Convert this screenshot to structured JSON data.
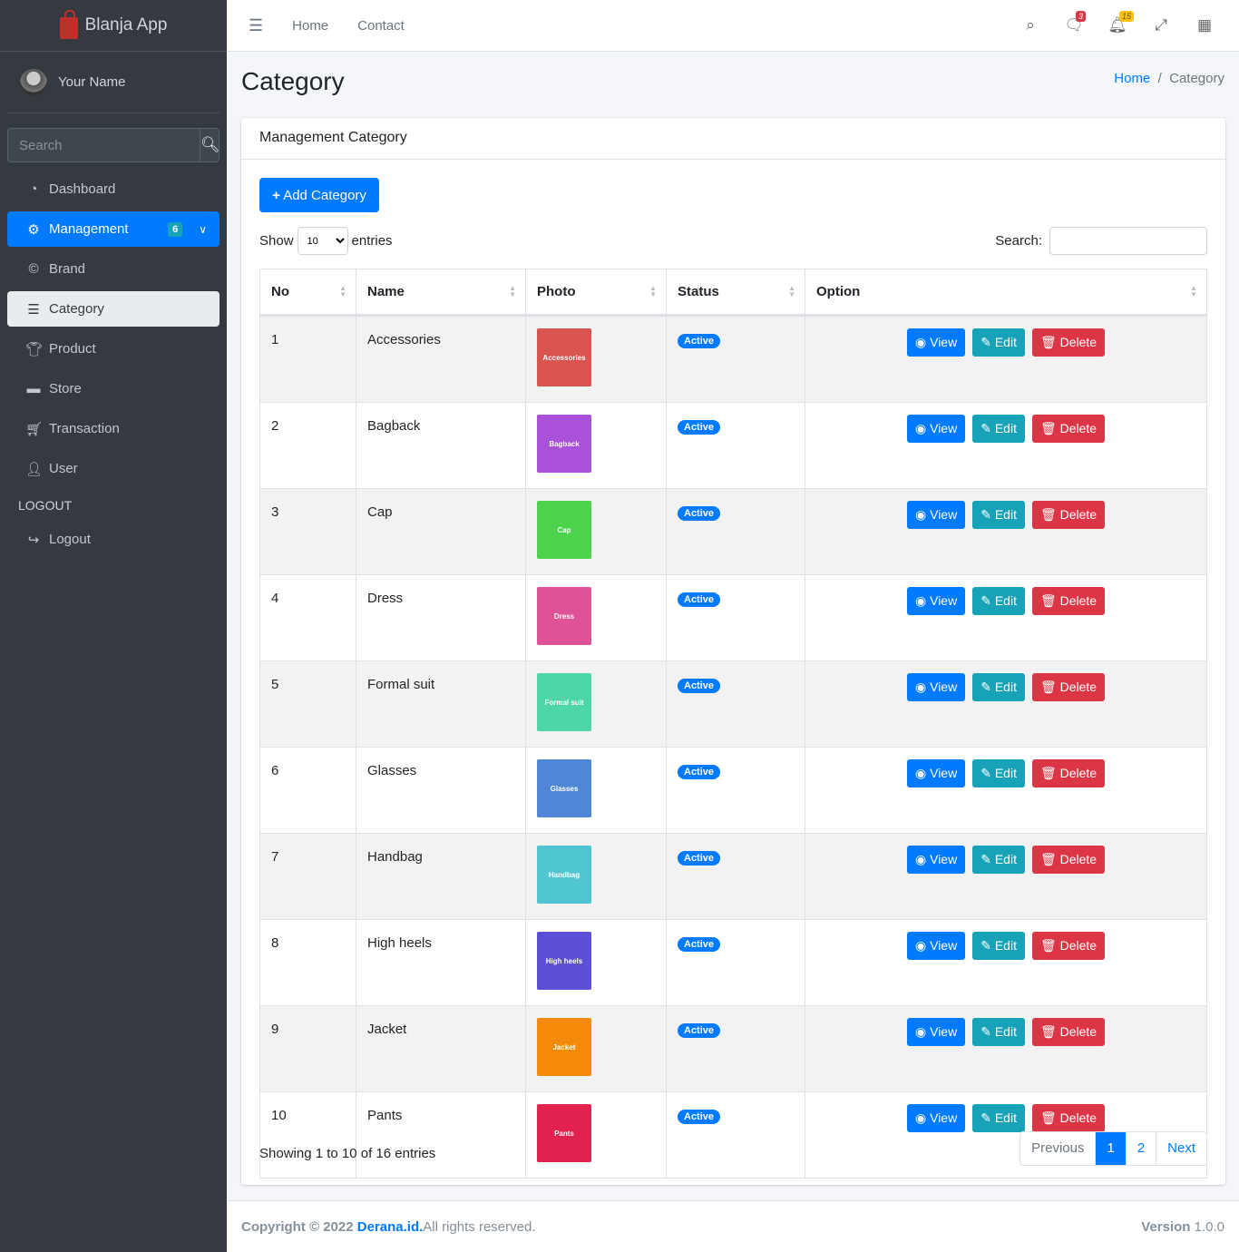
{
  "app": {
    "name": "Blanja App",
    "user": "Your Name"
  },
  "sidebar": {
    "search_placeholder": "Search",
    "items": [
      {
        "label": "Dashboard",
        "icon": "tachometer-icon"
      },
      {
        "label": "Management",
        "icon": "gear-icon",
        "badge": "6"
      },
      {
        "label": "Brand",
        "icon": "copyright-icon"
      },
      {
        "label": "Category",
        "icon": "list-icon"
      },
      {
        "label": "Product",
        "icon": "tshirt-icon"
      },
      {
        "label": "Store",
        "icon": "store-icon"
      },
      {
        "label": "Transaction",
        "icon": "cart-icon"
      },
      {
        "label": "User",
        "icon": "user-icon"
      }
    ],
    "header": "LOGOUT",
    "logout": "Logout"
  },
  "topbar": {
    "home": "Home",
    "contact": "Contact",
    "messages_count": "3",
    "notifications_count": "15"
  },
  "page": {
    "title": "Category",
    "breadcrumb": [
      "Home",
      "Category"
    ]
  },
  "card": {
    "title": "Management Category",
    "add_label": "Add Category",
    "show_label": "Show",
    "entries_label": "entries",
    "page_size": "10",
    "search_label": "Search:",
    "columns": [
      "No",
      "Name",
      "Photo",
      "Status",
      "Option"
    ],
    "rows": [
      {
        "no": "1",
        "name": "Accessories",
        "status": "Active",
        "color": "#d9534f"
      },
      {
        "no": "2",
        "name": "Bagback",
        "status": "Active",
        "color": "#a951d8"
      },
      {
        "no": "3",
        "name": "Cap",
        "status": "Active",
        "color": "#4cd34c"
      },
      {
        "no": "4",
        "name": "Dress",
        "status": "Active",
        "color": "#df5297"
      },
      {
        "no": "5",
        "name": "Formal suit",
        "status": "Active",
        "color": "#4fd6a6"
      },
      {
        "no": "6",
        "name": "Glasses",
        "status": "Active",
        "color": "#4f86d6"
      },
      {
        "no": "7",
        "name": "Handbag",
        "status": "Active",
        "color": "#4fc6d0"
      },
      {
        "no": "8",
        "name": "High heels",
        "status": "Active",
        "color": "#5a4fd6"
      },
      {
        "no": "9",
        "name": "Jacket",
        "status": "Active",
        "color": "#f58a0a"
      },
      {
        "no": "10",
        "name": "Pants",
        "status": "Active",
        "color": "#e22350"
      }
    ],
    "actions": {
      "view": "View",
      "edit": "Edit",
      "delete": "Delete"
    },
    "info": "Showing 1 to 10 of 16 entries",
    "pagination": {
      "previous": "Previous",
      "pages": [
        "1",
        "2"
      ],
      "next": "Next",
      "current": "1"
    }
  },
  "footer": {
    "copyright": "Copyright © 2022 ",
    "link": "Derana.id.",
    "rights": "All rights reserved.",
    "version_label": "Version",
    "version": " 1.0.0"
  }
}
